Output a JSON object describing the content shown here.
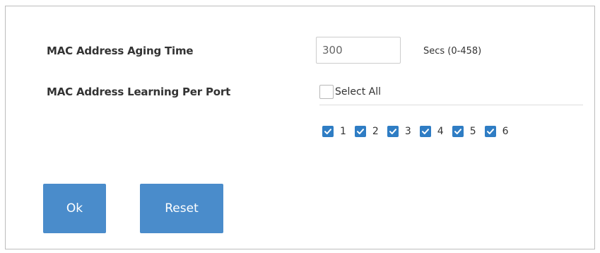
{
  "form": {
    "aging_label": "MAC Address Aging Time",
    "aging_value": "300",
    "aging_units": "Secs (0-458)",
    "learning_label": "MAC Address Learning Per Port",
    "select_all_label": "Select All",
    "select_all_checked": false,
    "ports": [
      {
        "label": "1",
        "checked": true
      },
      {
        "label": "2",
        "checked": true
      },
      {
        "label": "3",
        "checked": true
      },
      {
        "label": "4",
        "checked": true
      },
      {
        "label": "5",
        "checked": true
      },
      {
        "label": "6",
        "checked": true
      }
    ]
  },
  "buttons": {
    "ok_label": "Ok",
    "reset_label": "Reset"
  },
  "colors": {
    "accent": "#4a8ccb",
    "checkbox": "#2f7dc4",
    "border": "#bdbdbd"
  },
  "icons": {
    "checked": "check-icon"
  }
}
